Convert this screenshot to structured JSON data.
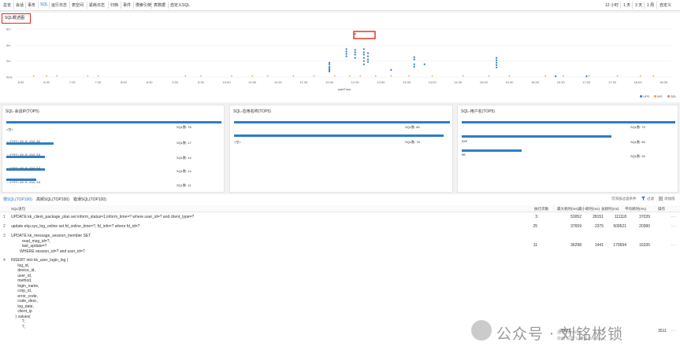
{
  "topnav": {
    "tabs": [
      "总览",
      "会话",
      "事务",
      "SQL",
      "运行日志",
      "表空间",
      "紧耗日志",
      "归档",
      "事件",
      "慢索引使",
      "表数据",
      "自定义SQL"
    ],
    "active_tab": "SQL",
    "ranges": [
      "12 小时",
      "1 天",
      "3 天",
      "1 周",
      "自定义"
    ]
  },
  "overview": {
    "title": "SQL概述图",
    "y_ticks": [
      "6m",
      "4m",
      "2m",
      "0ms"
    ],
    "x_ticks": [
      "8:00",
      "8:30",
      "7:00",
      "7:30",
      "8:00",
      "8:30",
      "9:00",
      "9:30",
      "10:00",
      "10:30",
      "11:00",
      "11:30",
      "12:00",
      "12:30",
      "13:00",
      "13:30",
      "14:00",
      "14:30",
      "15:00",
      "15:30",
      "16:00",
      "16:30",
      "17:00",
      "17:30",
      "18:00",
      "18:30"
    ],
    "xlabel": "startTime",
    "legend": [
      {
        "name": "UPD",
        "color": "#2d7ec7"
      },
      {
        "name": "INS",
        "color": "#f0a030"
      },
      {
        "name": "SEL",
        "color": "#f07850"
      }
    ]
  },
  "chart_data": {
    "type": "scatter",
    "xlabel": "startTime",
    "ylabel": "",
    "ylim": [
      0,
      6
    ],
    "series": [
      {
        "name": "UPD",
        "points": [
          [
            12.0,
            0.7
          ],
          [
            12.0,
            0.9
          ],
          [
            12.0,
            1.1
          ],
          [
            12.0,
            1.3
          ],
          [
            12.0,
            1.6
          ],
          [
            12.0,
            1.8
          ],
          [
            12.33,
            2.6
          ],
          [
            12.33,
            2.9
          ],
          [
            12.33,
            3.2
          ],
          [
            12.33,
            3.5
          ],
          [
            12.5,
            2.4
          ],
          [
            12.5,
            2.8
          ],
          [
            12.5,
            3.1
          ],
          [
            12.5,
            3.4
          ],
          [
            12.67,
            1.6
          ],
          [
            12.67,
            2.0
          ],
          [
            12.67,
            2.4
          ],
          [
            12.67,
            2.8
          ],
          [
            12.67,
            3.1
          ],
          [
            12.67,
            3.5
          ],
          [
            12.75,
            1.9
          ],
          [
            12.75,
            2.2
          ],
          [
            12.75,
            2.6
          ],
          [
            12.75,
            3.0
          ],
          [
            13.2,
            0.9
          ],
          [
            13.65,
            1.3
          ],
          [
            13.65,
            1.6
          ],
          [
            13.65,
            2.2
          ],
          [
            13.65,
            2.5
          ],
          [
            13.85,
            1.6
          ],
          [
            15.25,
            1.2
          ],
          [
            15.25,
            1.5
          ],
          [
            15.25,
            1.8
          ],
          [
            15.25,
            2.1
          ],
          [
            15.25,
            2.4
          ],
          [
            16.4,
            0.1
          ],
          [
            17.0,
            0.1
          ]
        ]
      },
      {
        "name": "INS",
        "points": [
          [
            6.25,
            0.15
          ],
          [
            6.5,
            0.15
          ],
          [
            6.7,
            0.15
          ],
          [
            7.3,
            0.15
          ],
          [
            7.5,
            0.15
          ],
          [
            9.2,
            0.15
          ],
          [
            9.5,
            0.15
          ],
          [
            10.1,
            0.15
          ],
          [
            10.5,
            0.15
          ],
          [
            10.8,
            0.15
          ],
          [
            11.3,
            0.15
          ],
          [
            11.7,
            0.15
          ],
          [
            12.1,
            0.15
          ],
          [
            12.4,
            0.15
          ],
          [
            12.6,
            0.15
          ],
          [
            12.9,
            0.15
          ],
          [
            13.2,
            0.15
          ],
          [
            13.55,
            0.15
          ],
          [
            14.0,
            0.15
          ],
          [
            14.6,
            0.15
          ],
          [
            15.1,
            0.15
          ],
          [
            15.5,
            0.15
          ],
          [
            16.2,
            0.15
          ],
          [
            16.55,
            0.15
          ],
          [
            17.05,
            0.15
          ],
          [
            17.6,
            0.15
          ],
          [
            18.05,
            0.15
          ],
          [
            18.3,
            0.15
          ]
        ]
      },
      {
        "name": "SEL",
        "points": [
          [
            12.5,
            5.4
          ]
        ]
      }
    ]
  },
  "cards": [
    {
      "title": "SQL-会话IP(TOP5)",
      "rows": [
        {
          "label": "<空>",
          "count": "SQL数: 78",
          "frac": 1.0
        },
        {
          "label": "::ffff:10.0.134.62",
          "count": "SQL数: 17",
          "frac": 0.22
        },
        {
          "label": "::ffff:10.0.134.53",
          "count": "SQL数: 14",
          "frac": 0.18
        },
        {
          "label": "::ffff:10.0.134.52",
          "count": "SQL数: 14",
          "frac": 0.18
        },
        {
          "label": "::ffff:10.0.134.54",
          "count": "SQL数: 11",
          "frac": 0.14
        }
      ]
    },
    {
      "title": "SQL-应用名称(TOP5)",
      "rows": [
        {
          "label": "",
          "count": "SQL数: 80",
          "frac": 1.0
        },
        {
          "label": "<空>",
          "count": "SQL数: 78",
          "frac": 0.97
        }
      ]
    },
    {
      "title": "SQL-用户名(TOP5)",
      "rows": [
        {
          "label": "",
          "count": "SQL数: 79",
          "frac": 1.0
        },
        {
          "label": "EKP",
          "count": "SQL数: 55",
          "frac": 0.7
        },
        {
          "label": "KK",
          "count": "SQL数: 26",
          "frac": 0.28
        }
      ]
    }
  ],
  "table": {
    "subtabs": [
      "慢SQL(TOP100)",
      "高频SQL(TOP100)",
      "错误SQL(TOP100)"
    ],
    "active_subtab": "慢SQL(TOP100)",
    "hint": "可添加过滤条件",
    "filter_label": "过滤",
    "add_label": "添加指",
    "headers": [
      "SQL语句",
      "执行次数",
      "最大耗时(ms)",
      "最小耗时(ms)",
      "总耗时(ms)",
      "平均耗时(ms)",
      "操作"
    ],
    "rows": [
      {
        "idx": "1",
        "sql": "UPDATE kk_client_package_plan set inform_status=1,inform_time=? where user_id=? and client_type=?",
        "count": "3",
        "max": "53052",
        "min": "28151",
        "total": "111118",
        "avg": "37039",
        "op": "···"
      },
      {
        "idx": "2",
        "sql": "update ekp.sys_log_online set fd_online_time=?, fd_info=? where fd_id=?",
        "count": "25",
        "max": "37659",
        "min": "2375",
        "total": "509521",
        "avg": "20380",
        "op": "···"
      },
      {
        "idx": "3",
        "sql": "UPDATE kk_message_session_member SET\n          read_msg_id=?,\n          last_update=?\n        WHERE session_id=? and user_id=?",
        "count": "11",
        "max": "36298",
        "min": "1441",
        "total": "179694",
        "avg": "16335",
        "op": "···"
      },
      {
        "idx": "4",
        "sql": "INSERT into kk_user_login_log (\n      log_id,\n      device_id,\n      user_id,\n      method,\n      login_name,\n      corp_id,\n      error_code,\n      code_desc,\n      log_date,\n      client_ip\n    ) values(\n          ?,\n          ?,",
        "count": "",
        "max": "26671",
        "min": "2",
        "total": "3511",
        "avg": "",
        "op": "···"
      }
    ]
  },
  "watermark": {
    "text": "公众号 · 刘铭彬锁",
    "sub1": "激活 Windows",
    "sub2": "转到\"设置\"以激活 Windows。"
  }
}
